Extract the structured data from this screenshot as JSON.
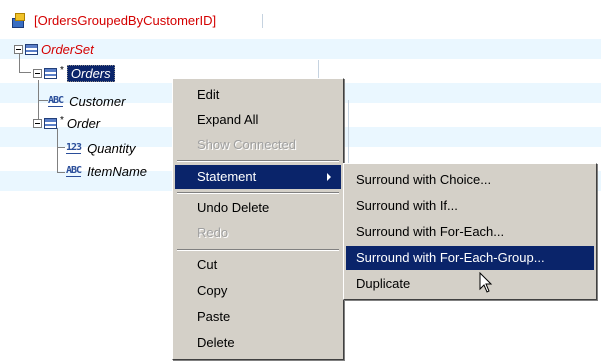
{
  "tree": {
    "root_label": "[OrdersGroupedByCustomerID]",
    "nodes": {
      "orderset": "OrderSet",
      "orders": "Orders",
      "customer": "Customer",
      "order": "Order",
      "quantity": "Quantity",
      "itemname": "ItemName"
    },
    "type_badges": {
      "string": "ABC",
      "number": "123"
    },
    "icons": {
      "root": "database-icon",
      "group": "table-icon"
    }
  },
  "context_menu": {
    "items": [
      "Edit",
      "Expand All",
      "Show Connected",
      "Statement",
      "Undo Delete",
      "Redo",
      "Cut",
      "Copy",
      "Paste",
      "Delete"
    ],
    "highlighted": "Statement"
  },
  "submenu": {
    "items": [
      "Surround with Choice...",
      "Surround with If...",
      "Surround with For-Each...",
      "Surround with For-Each-Group...",
      "Duplicate"
    ],
    "highlighted": "Surround with For-Each-Group..."
  },
  "colors": {
    "selection": "#0a246a",
    "menu_bg": "#d4d0c8",
    "row_alt": "#eaf7ff",
    "red_text": "#d40000"
  }
}
